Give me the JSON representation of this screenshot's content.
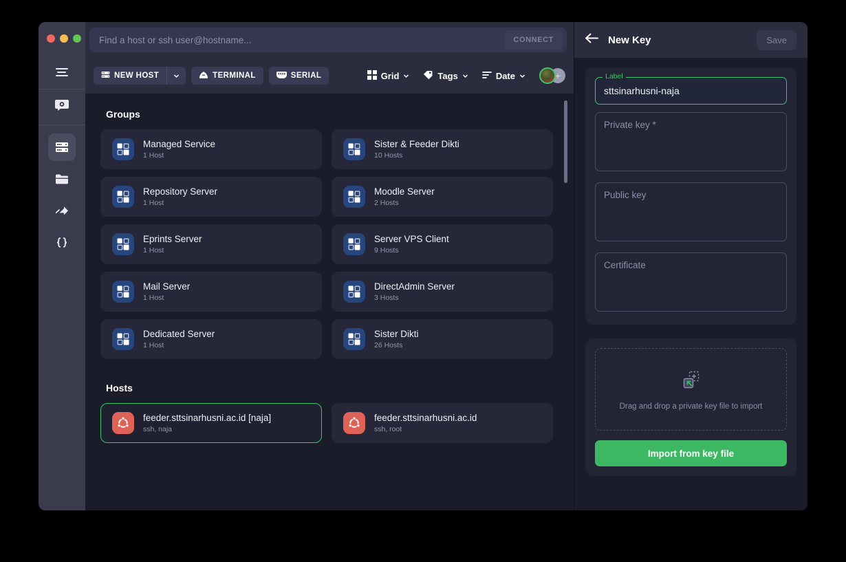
{
  "window": {
    "traffic_lights": [
      "close",
      "minimize",
      "maximize"
    ]
  },
  "rail": {
    "menu_icon": "hamburger-icon",
    "items": [
      {
        "icon": "vault-icon",
        "name": "vault",
        "active": false
      },
      {
        "icon": "server-rack-icon",
        "name": "hosts",
        "active": true
      },
      {
        "icon": "folder-icon",
        "name": "folders",
        "active": false
      },
      {
        "icon": "port-forwarding-icon",
        "name": "port-forwarding",
        "active": false
      },
      {
        "icon": "code-braces-icon",
        "name": "snippets",
        "active": false
      }
    ]
  },
  "search": {
    "placeholder": "Find a host or ssh user@hostname...",
    "value": "",
    "connect_label": "CONNECT"
  },
  "toolbar": {
    "new_host_label": "NEW HOST",
    "terminal_label": "TERMINAL",
    "serial_label": "SERIAL",
    "view_label": "Grid",
    "tags_label": "Tags",
    "sort_label": "Date",
    "add_account_label": "+"
  },
  "content": {
    "groups_title": "Groups",
    "groups": [
      {
        "name": "Managed Service",
        "hosts": "1 Host"
      },
      {
        "name": "Sister & Feeder Dikti",
        "hosts": "10 Hosts"
      },
      {
        "name": "Repository Server",
        "hosts": "1 Host"
      },
      {
        "name": "Moodle Server",
        "hosts": "2 Hosts"
      },
      {
        "name": "Eprints Server",
        "hosts": "1 Host"
      },
      {
        "name": "Server VPS Client",
        "hosts": "9 Hosts"
      },
      {
        "name": "Mail Server",
        "hosts": "1 Host"
      },
      {
        "name": "DirectAdmin Server",
        "hosts": "3 Hosts"
      },
      {
        "name": "Dedicated Server",
        "hosts": "1 Host"
      },
      {
        "name": "Sister Dikti",
        "hosts": "26 Hosts"
      }
    ],
    "hosts_title": "Hosts",
    "hosts": [
      {
        "name": "feeder.sttsinarhusni.ac.id [naja]",
        "meta": "ssh, naja",
        "selected": true
      },
      {
        "name": "feeder.sttsinarhusni.ac.id",
        "meta": "ssh, root",
        "selected": false
      }
    ]
  },
  "panel": {
    "back_icon": "arrow-left-icon",
    "title": "New Key",
    "save_label": "Save",
    "label_caption": "Label",
    "label_value": "sttsinarhusni-naja",
    "private_key_placeholder": "Private key *",
    "private_key_value": "",
    "public_key_placeholder": "Public key",
    "public_key_value": "",
    "certificate_placeholder": "Certificate",
    "certificate_value": "",
    "dropzone_text": "Drag and drop a private key file to import",
    "dropzone_icon": "file-add-icon",
    "import_label": "Import from key file"
  },
  "colors": {
    "accent_green": "#3ec46d",
    "import_button": "#3cb862",
    "group_icon": "#27467e",
    "host_icon": "#e06257",
    "window_bg": "#1b1c2a",
    "panel_bg": "#2b2d3e",
    "rail_bg": "#3a3b4d"
  }
}
